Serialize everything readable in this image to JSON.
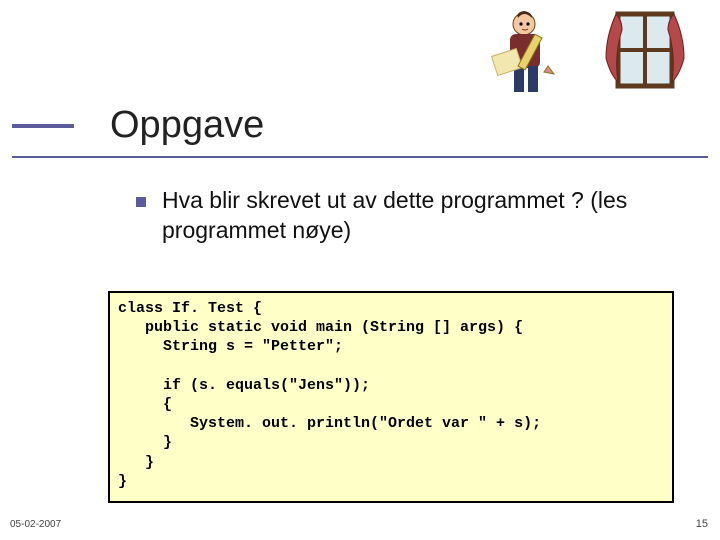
{
  "title": "Oppgave",
  "bullet": "Hva blir skrevet ut av dette programmet ? (les programmet nøye)",
  "code_lines": [
    "class If. Test {",
    "   public static void main (String [] args) {",
    "     String s = \"Petter\";",
    "",
    "     if (s. equals(\"Jens\"));",
    "     {",
    "        System. out. println(\"Ordet var \" + s);",
    "     }",
    "   }",
    "}"
  ],
  "footer": {
    "date": "05-02-2007",
    "page": "15"
  },
  "clipart": {
    "man": "man-with-pencil-paper",
    "window": "window-with-curtains"
  }
}
